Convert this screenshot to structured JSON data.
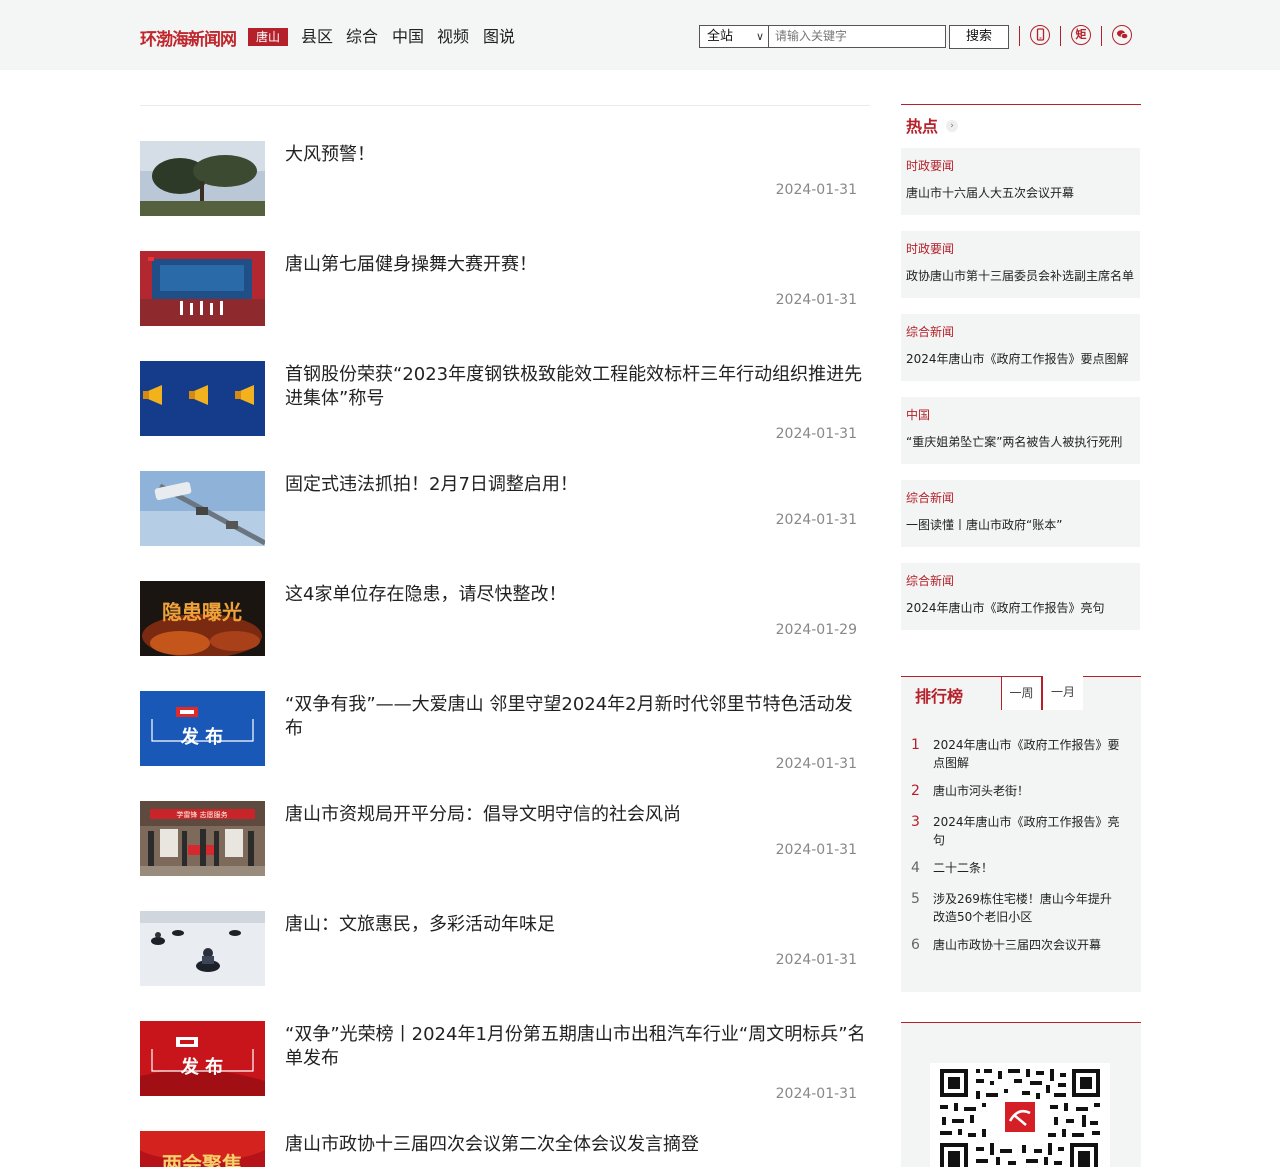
{
  "header": {
    "logo": "环渤海新闻网",
    "current_channel": "唐山",
    "nav": [
      "县区",
      "综合",
      "中国",
      "视频",
      "图说"
    ],
    "search": {
      "scope": "全站",
      "placeholder": "请输入关键字",
      "button": "搜索"
    },
    "icons": [
      "mobile-icon",
      "ju-icon",
      "wechat-icon"
    ],
    "icon_ju_char": "矩"
  },
  "articles": [
    {
      "title": "大风预警！",
      "date": "2024-01-31",
      "thumb": "tree-sky"
    },
    {
      "title": "唐山第七届健身操舞大赛开赛！",
      "date": "2024-01-31",
      "thumb": "gym-stage"
    },
    {
      "title": "首钢股份荣获“2023年度钢铁极致能效工程能效标杆三年行动组织推进先进集体”称号",
      "date": "2024-01-31",
      "thumb": "megaphones"
    },
    {
      "title": "固定式违法抓拍！2月7日调整启用！",
      "date": "2024-01-31",
      "thumb": "traffic-camera"
    },
    {
      "title": "这4家单位存在隐患，请尽快整改！",
      "date": "2024-01-29",
      "thumb": "hazard-expose"
    },
    {
      "title": "“双争有我”——大爱唐山 邻里守望2024年2月新时代邻里节特色活动发布",
      "date": "2024-01-31",
      "thumb": "publish-blue"
    },
    {
      "title": "唐山市资规局开平分局：倡导文明守信的社会风尚",
      "date": "2024-01-31",
      "thumb": "crowd-banner"
    },
    {
      "title": "唐山：文旅惠民，多彩活动年味足",
      "date": "2024-01-31",
      "thumb": "snow-atv"
    },
    {
      "title": "“双争”光荣榜丨2024年1月份第五期唐山市出租汽车行业“周文明标兵”名单发布",
      "date": "2024-01-31",
      "thumb": "publish-red"
    },
    {
      "title": "唐山市政协十三届四次会议第二次全体会议发言摘登",
      "date": "",
      "thumb": "two-sessions"
    }
  ],
  "thumb_text": {
    "hazard": "隐患曝光",
    "publish": "发 布",
    "sessions": "两会聚焦",
    "banner": "学雷锋 志愿服务"
  },
  "hot": {
    "title": "热点",
    "more": "›",
    "items": [
      {
        "category": "时政要闻",
        "text": "唐山市十六届人大五次会议开幕"
      },
      {
        "category": "时政要闻",
        "text": "政协唐山市第十三届委员会补选副主席名单"
      },
      {
        "category": "综合新闻",
        "text": "2024年唐山市《政府工作报告》要点图解"
      },
      {
        "category": "中国",
        "text": "“重庆姐弟坠亡案”两名被告人被执行死刑"
      },
      {
        "category": "综合新闻",
        "text": "一图读懂丨唐山市政府“账本”"
      },
      {
        "category": "综合新闻",
        "text": "2024年唐山市《政府工作报告》亮句"
      }
    ]
  },
  "ranking": {
    "title": "排行榜",
    "tabs": [
      "一周",
      "一月"
    ],
    "active_tab": "一周",
    "items": [
      {
        "rank": "1",
        "text": "2024年唐山市《政府工作报告》要点图解"
      },
      {
        "rank": "2",
        "text": "唐山市河头老街！"
      },
      {
        "rank": "3",
        "text": "2024年唐山市《政府工作报告》亮句"
      },
      {
        "rank": "4",
        "text": "二十二条！"
      },
      {
        "rank": "5",
        "text": "涉及269栋住宅楼！唐山今年提升改造50个老旧小区"
      },
      {
        "rank": "6",
        "text": "唐山市政协十三届四次会议开幕"
      }
    ]
  },
  "colors": {
    "brand_red": "#b5212a",
    "rank_top": "#b5212a",
    "rank_other": "#666666"
  }
}
